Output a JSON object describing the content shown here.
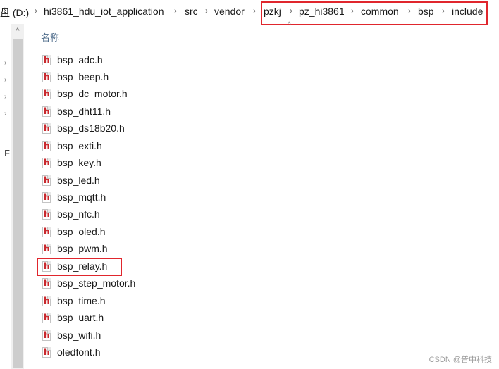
{
  "breadcrumb": [
    {
      "label": "盘 (D:)"
    },
    {
      "label": "hi3861_hdu_iot_application"
    },
    {
      "label": "src"
    },
    {
      "label": "vendor"
    },
    {
      "label": "pzkj"
    },
    {
      "label": "pz_hi3861"
    },
    {
      "label": "common"
    },
    {
      "label": "bsp"
    },
    {
      "label": "include"
    }
  ],
  "column_header": {
    "name": "名称",
    "sort_icon": "chevron-up-icon"
  },
  "left_glyph": "F",
  "files": [
    {
      "name": "bsp_adc.h"
    },
    {
      "name": "bsp_beep.h"
    },
    {
      "name": "bsp_dc_motor.h"
    },
    {
      "name": "bsp_dht11.h"
    },
    {
      "name": "bsp_ds18b20.h"
    },
    {
      "name": "bsp_exti.h"
    },
    {
      "name": "bsp_key.h"
    },
    {
      "name": "bsp_led.h"
    },
    {
      "name": "bsp_mqtt.h"
    },
    {
      "name": "bsp_nfc.h"
    },
    {
      "name": "bsp_oled.h"
    },
    {
      "name": "bsp_pwm.h"
    },
    {
      "name": "bsp_relay.h",
      "highlighted": true
    },
    {
      "name": "bsp_step_motor.h"
    },
    {
      "name": "bsp_time.h"
    },
    {
      "name": "bsp_uart.h"
    },
    {
      "name": "bsp_wifi.h"
    },
    {
      "name": "oledfont.h"
    }
  ],
  "file_icon_letter": "h",
  "highlight_color": "#e0262d",
  "watermark": "CSDN @普中科技"
}
